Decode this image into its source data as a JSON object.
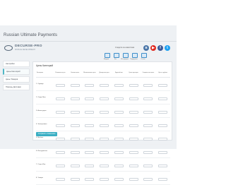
{
  "app": {
    "title": "Russian Ultimate Payments"
  },
  "logo": {
    "name": "DECURSE-PRO",
    "tagline": "MODULE DEVELOPMENT"
  },
  "social": {
    "label": "Следите за новостями",
    "items": [
      {
        "icon": "vk-icon",
        "glyph": "в",
        "color": "#4a76a8"
      },
      {
        "icon": "youtube-icon",
        "glyph": "▶",
        "color": "#e02a20"
      },
      {
        "icon": "facebook-icon",
        "glyph": "f",
        "color": "#3b5998"
      },
      {
        "icon": "twitter-icon",
        "glyph": "t",
        "color": "#1da1f2"
      }
    ]
  },
  "toolbar": {
    "labels": [
      "Модули",
      "Чат",
      "Инструкция",
      "Поддержка",
      "Отзыв"
    ]
  },
  "sidebar": {
    "items": [
      {
        "label": "Настройки",
        "active": false
      },
      {
        "label": "Цены Категорий",
        "active": true
      },
      {
        "label": "Цены Товаров",
        "active": false
      },
      {
        "label": "Помощь Доставки",
        "active": false
      }
    ]
  },
  "panel": {
    "heading": "Цены Категорий"
  },
  "table": {
    "headers": [
      "Категория",
      "Розничная цена",
      "Оптовая цена",
      "Мелкооптовая цена",
      "Дилерская цена",
      "Крупный опт",
      "Цена партнера",
      "Специальная цена",
      "Цена в рублях"
    ],
    "rows": [
      "1. Одежда",
      "2. Обувь Мен",
      "3. Аксессуары",
      "4. Электроника",
      "5. Мебель",
      "6. Инструменты",
      "7. Спорт Инв.",
      "8. Товары"
    ]
  },
  "actions": {
    "save_label": "Сохранить изменения"
  },
  "colors": {
    "accent": "#3aaec3",
    "frame": "#eef1f4"
  }
}
